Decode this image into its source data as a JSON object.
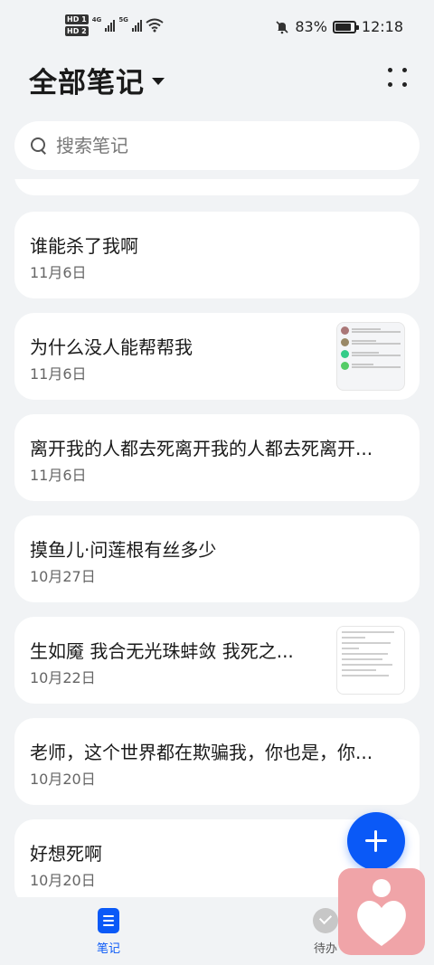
{
  "status_bar": {
    "hd1": "HD 1",
    "hd2": "HD 2",
    "net1": "4G",
    "net2": "5G",
    "battery_percent": "83%",
    "battery_level": 0.83,
    "time": "12:18"
  },
  "header": {
    "title": "全部笔记"
  },
  "search": {
    "placeholder": "搜索笔记"
  },
  "notes": [
    {
      "title": "谁能杀了我啊",
      "date": "11月6日",
      "thumbnail": null
    },
    {
      "title": "为什么没人能帮帮我",
      "date": "11月6日",
      "thumbnail": "chat-screenshot"
    },
    {
      "title": "离开我的人都去死离开我的人都去死离开...",
      "date": "11月6日",
      "thumbnail": null
    },
    {
      "title": "摸鱼儿·问莲根有丝多少",
      "date": "10月27日",
      "thumbnail": null
    },
    {
      "title": "生如魇 我合无光珠蚌敛 我死之...",
      "date": "10月22日",
      "thumbnail": "text-document"
    },
    {
      "title": "老师，这个世界都在欺骗我，你也是，你...",
      "date": "10月20日",
      "thumbnail": null
    },
    {
      "title": "好想死啊",
      "date": "10月20日",
      "thumbnail": null
    }
  ],
  "bottom_nav": {
    "notes_label": "笔记",
    "todo_label": "待办"
  },
  "colors": {
    "accent": "#0a59f7",
    "background": "#f1f3f5",
    "card": "#ffffff",
    "widget": "#f0a4a8"
  }
}
